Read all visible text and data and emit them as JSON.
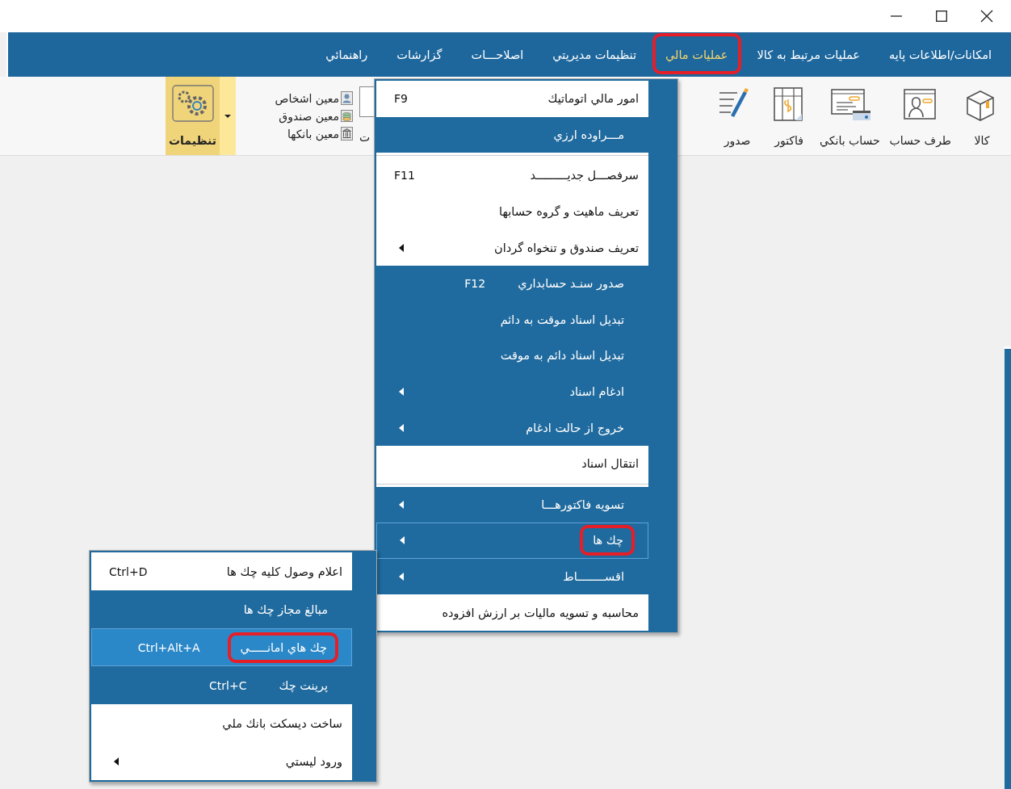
{
  "menubar": [
    {
      "label": "امکانات/اطلاعات پايه",
      "selected": false,
      "annotated": false
    },
    {
      "label": "عمليات مرتبط به كالا",
      "selected": false,
      "annotated": false
    },
    {
      "label": "عمليات مالي",
      "selected": true,
      "annotated": true
    },
    {
      "label": "تنظيمات مديريتي",
      "selected": false,
      "annotated": false
    },
    {
      "label": "اصلاحـــات",
      "selected": false,
      "annotated": false
    },
    {
      "label": "گزارشات",
      "selected": false,
      "annotated": false
    },
    {
      "label": "راهنمائي",
      "selected": false,
      "annotated": false
    }
  ],
  "toolbar": {
    "large_buttons": [
      {
        "label": "کالا"
      },
      {
        "label": "طرف حساب"
      },
      {
        "label": "حساب بانکي"
      },
      {
        "label": "فاکتور"
      },
      {
        "label": "صدور"
      }
    ],
    "partial_button": {
      "label": "ت"
    },
    "small_buttons": [
      {
        "label": "معين اشخاص"
      },
      {
        "label": "معين صندوق"
      },
      {
        "label": "معين بانكها"
      }
    ],
    "settings_button": {
      "label": "تنظيمات",
      "selected": true
    }
  },
  "finance_menu": [
    {
      "kind": "light_item",
      "label": "امور مالي اتوماتيك",
      "shortcut": "F9",
      "submenu": false,
      "selected": false,
      "annotated": false
    },
    {
      "kind": "dark_item",
      "label": "مـــراوده ارزي",
      "submenu": false,
      "selected": false,
      "annotated": false
    },
    {
      "kind": "separator"
    },
    {
      "kind": "light_item",
      "label": "سرفصـــل جديـــــــــد",
      "shortcut": "F11",
      "submenu": false,
      "selected": false,
      "annotated": false
    },
    {
      "kind": "light_item",
      "label": "تعريف ماهيت و گروه حسابها",
      "submenu": false,
      "selected": false,
      "annotated": false
    },
    {
      "kind": "light_item",
      "label": "تعريف صندوق و تنخواه گردان",
      "submenu": true,
      "selected": false,
      "annotated": false
    },
    {
      "kind": "dark_item",
      "label": "صدور سنـد حسابداري",
      "shortcut": "F12",
      "submenu": false,
      "selected": false,
      "annotated": false
    },
    {
      "kind": "dark_item",
      "label": "تبديل اسناد موقت به دائم",
      "submenu": false,
      "selected": false,
      "annotated": false
    },
    {
      "kind": "dark_item",
      "label": "تبديل اسناد دائم به موقت",
      "submenu": false,
      "selected": false,
      "annotated": false
    },
    {
      "kind": "dark_item",
      "label": "ادغام اسناد",
      "submenu": true,
      "selected": false,
      "annotated": false
    },
    {
      "kind": "dark_item",
      "label": "خروج از حالت ادغام",
      "submenu": true,
      "selected": false,
      "annotated": false
    },
    {
      "kind": "light_item",
      "label": "انتقال اسناد",
      "submenu": false,
      "selected": false,
      "annotated": false
    },
    {
      "kind": "separator"
    },
    {
      "kind": "dark_item",
      "label": "تسويه فاكتورهـــا",
      "submenu": true,
      "selected": false,
      "annotated": false
    },
    {
      "kind": "dark_item",
      "label": "چك ها",
      "submenu": true,
      "selected": true,
      "annotated": true
    },
    {
      "kind": "dark_item",
      "label": "اقســــــــاط",
      "submenu": true,
      "selected": false,
      "annotated": false
    },
    {
      "kind": "light_item",
      "label": "محاسبه و تسويه ماليات بر ارزش افزوده",
      "submenu": false,
      "selected": false,
      "annotated": false
    }
  ],
  "cheques_submenu": [
    {
      "kind": "light_item",
      "label": "اعلام وصول كليه چك ها",
      "shortcut": "Ctrl+D",
      "submenu": false,
      "selected": false,
      "annotated": false
    },
    {
      "kind": "dark_item",
      "label": "مبالغ مجاز چك ها",
      "submenu": false,
      "selected": false,
      "annotated": false
    },
    {
      "kind": "dark_item",
      "label": "چك هاي امانـــــي",
      "shortcut": "Ctrl+Alt+A",
      "submenu": false,
      "selected": true,
      "annotated": true
    },
    {
      "kind": "dark_item",
      "label": "پرينت چك",
      "shortcut": "Ctrl+C",
      "submenu": false,
      "selected": false,
      "annotated": false
    },
    {
      "kind": "light_item",
      "label": "ساخت ديسكت بانك ملي",
      "submenu": false,
      "selected": false,
      "annotated": false
    },
    {
      "kind": "light_item",
      "label": "ورود ليستي",
      "submenu": true,
      "selected": false,
      "annotated": false
    }
  ]
}
